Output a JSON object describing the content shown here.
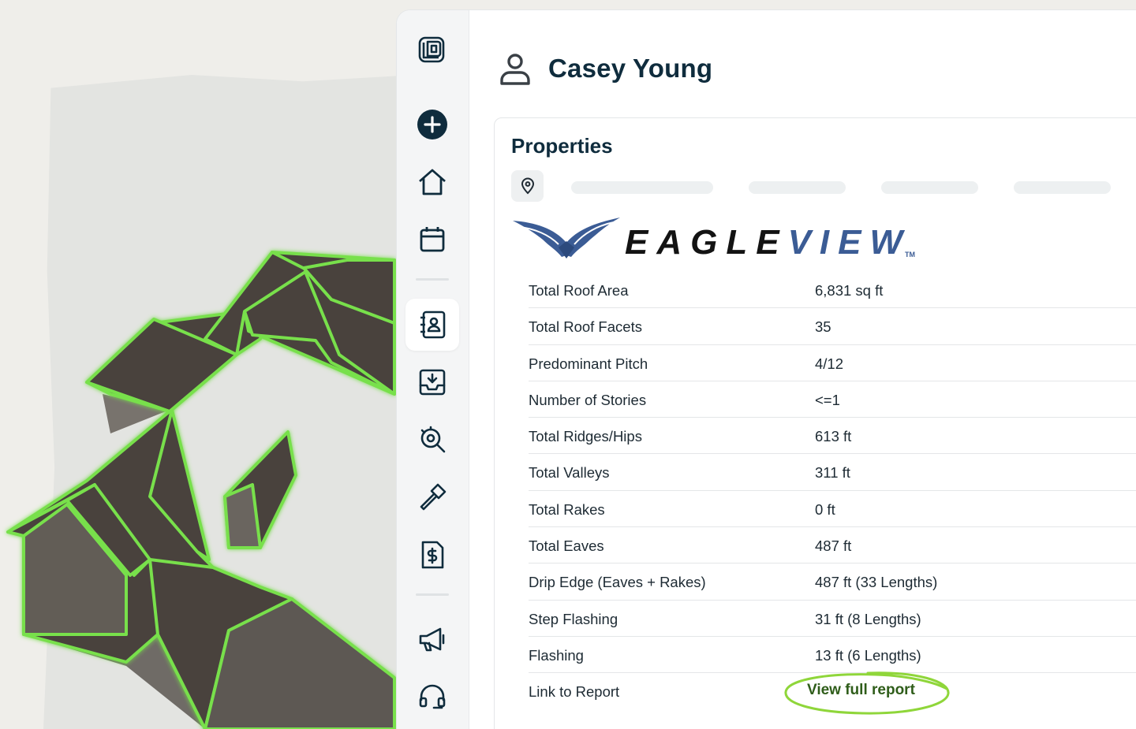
{
  "user": {
    "name": "Casey Young",
    "icon": "person-icon"
  },
  "sidebar": {
    "logo_icon": "app-logo-icon",
    "items": [
      {
        "name": "add",
        "icon": "plus-circle-icon"
      },
      {
        "name": "home",
        "icon": "home-icon"
      },
      {
        "name": "calendar",
        "icon": "calendar-icon"
      },
      {
        "name": "contacts",
        "icon": "contact-book-icon",
        "active": true
      },
      {
        "name": "inbox",
        "icon": "inbox-download-icon"
      },
      {
        "name": "inspection",
        "icon": "search-gear-icon"
      },
      {
        "name": "jobs",
        "icon": "hammer-icon"
      },
      {
        "name": "invoices",
        "icon": "dollar-document-icon"
      },
      {
        "name": "marketing",
        "icon": "megaphone-icon"
      },
      {
        "name": "support",
        "icon": "headset-icon"
      }
    ]
  },
  "properties": {
    "title": "Properties",
    "location_icon": "map-pin-icon",
    "provider_logo": {
      "text_left": "EAGLE",
      "text_right": "VIEW",
      "tm": "TM",
      "colors": {
        "dark": "#131313",
        "blue": "#3b5c95"
      }
    },
    "rows": [
      {
        "label": "Total Roof Area",
        "value": "6,831 sq ft"
      },
      {
        "label": "Total Roof Facets",
        "value": "35"
      },
      {
        "label": "Predominant Pitch",
        "value": "4/12"
      },
      {
        "label": "Number of Stories",
        "value": "<=1"
      },
      {
        "label": "Total Ridges/Hips",
        "value": "613 ft"
      },
      {
        "label": "Total Valleys",
        "value": "311 ft"
      },
      {
        "label": "Total Rakes",
        "value": "0 ft"
      },
      {
        "label": "Total Eaves",
        "value": "487 ft"
      },
      {
        "label": "Drip Edge (Eaves + Rakes)",
        "value": "487 ft (33 Lengths)"
      },
      {
        "label": "Step Flashing",
        "value": "31 ft (8 Lengths)"
      },
      {
        "label": "Flashing",
        "value": "13 ft (6 Lengths)"
      }
    ],
    "report_row": {
      "label": "Link to Report",
      "link_text": "View full report"
    }
  },
  "colors": {
    "accent_green": "#79d64a",
    "navy": "#0f2c3d",
    "link_green": "#2f5d1a"
  }
}
